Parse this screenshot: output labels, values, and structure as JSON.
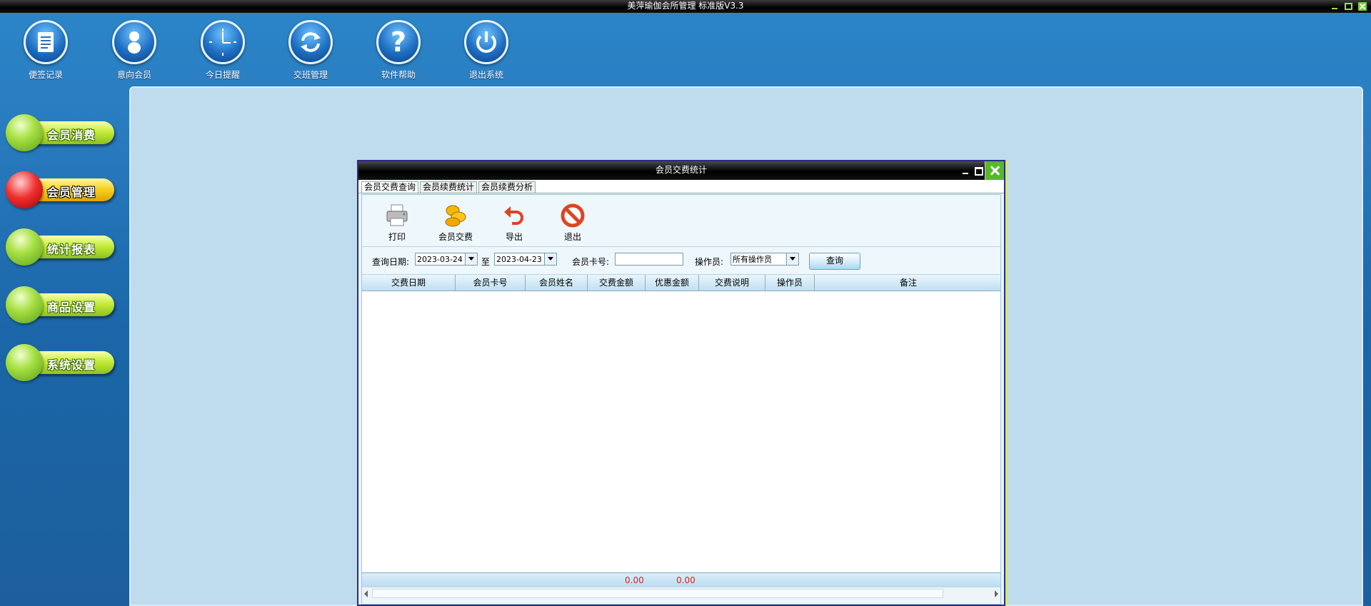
{
  "app": {
    "title": "美萍瑜伽会所管理 标准版V3.3"
  },
  "toolbar": {
    "items": [
      {
        "label": "便签记录",
        "icon": "notepad-icon"
      },
      {
        "label": "意向会员",
        "icon": "person-icon"
      },
      {
        "label": "今日提醒",
        "icon": "clock-icon"
      },
      {
        "label": "交班管理",
        "icon": "refresh-icon"
      },
      {
        "label": "软件帮助",
        "icon": "help-icon"
      },
      {
        "label": "退出系统",
        "icon": "power-icon"
      }
    ]
  },
  "nav": {
    "items": [
      {
        "label": "会员消费",
        "active": false
      },
      {
        "label": "会员管理",
        "active": true
      },
      {
        "label": "统计报表",
        "active": false
      },
      {
        "label": "商品设置",
        "active": false
      },
      {
        "label": "系统设置",
        "active": false
      }
    ]
  },
  "dialog": {
    "title": "会员交费统计",
    "tabs": [
      "会员交费查询",
      "会员续费统计",
      "会员续费分析"
    ],
    "tools": {
      "print": "打印",
      "pay": "会员交费",
      "export": "导出",
      "exit": "退出"
    },
    "filter": {
      "date_label": "查询日期:",
      "date_from": "2023-03-24",
      "to_label": "至",
      "date_to": "2023-04-23",
      "card_label": "会员卡号:",
      "card_value": "",
      "operator_label": "操作员:",
      "operator_value": "所有操作员",
      "query_label": "查询"
    },
    "columns": [
      "交费日期",
      "会员卡号",
      "会员姓名",
      "交费金额",
      "优惠金额",
      "交费说明",
      "操作员",
      "备注"
    ],
    "totals": {
      "pay_amount": "0.00",
      "discount_amount": "0.00"
    }
  },
  "colors": {
    "accent": "#2a86c8",
    "nav_green": "#c6ec3a",
    "nav_active": "#f7cf1a",
    "total_red": "#d21111"
  }
}
